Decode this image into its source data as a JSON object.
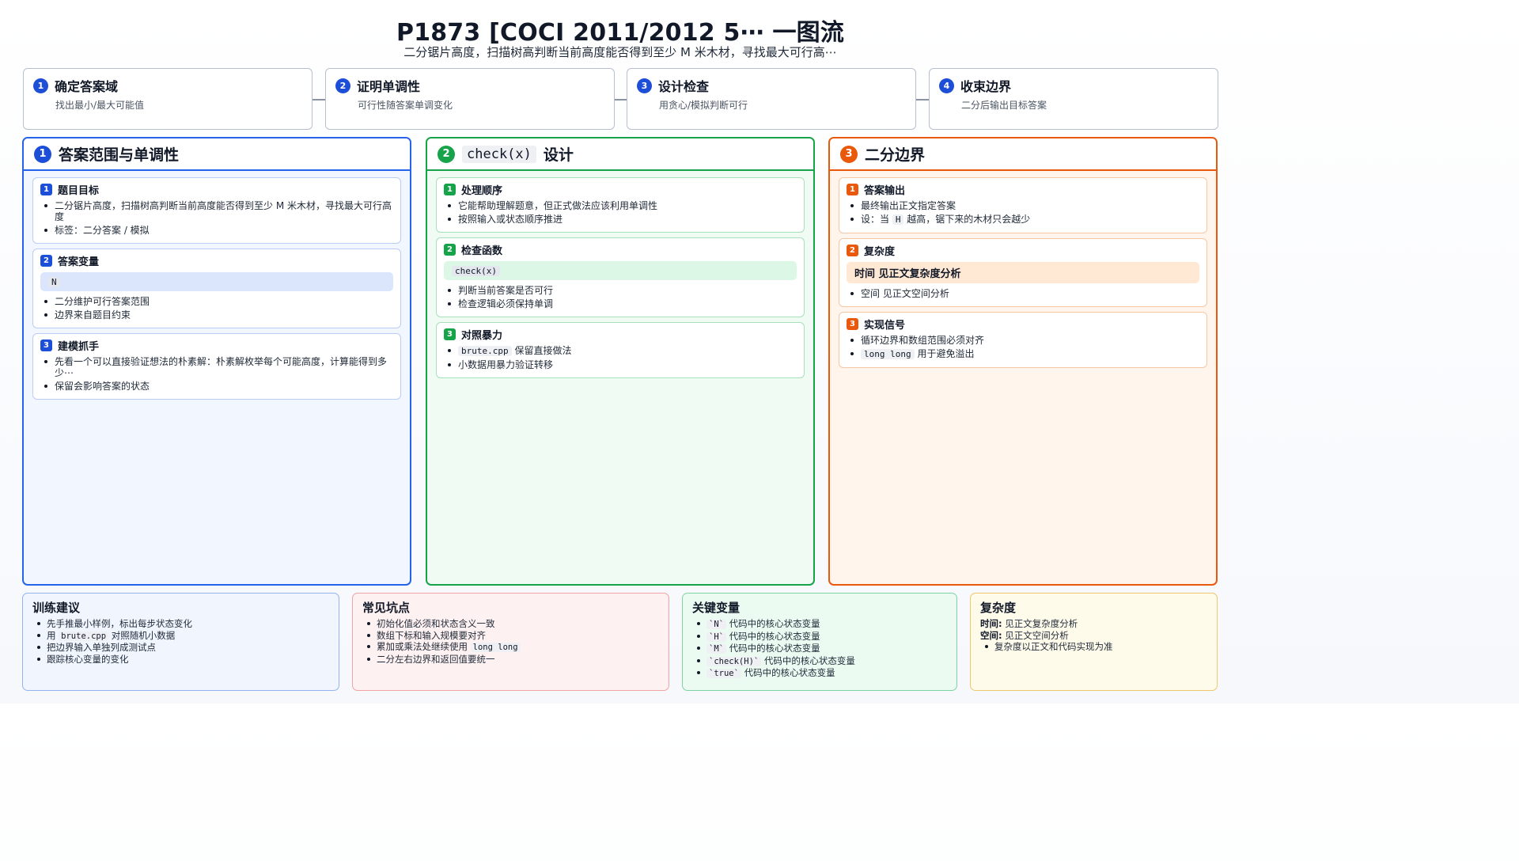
{
  "header": {
    "title": "P1873 [COCI 2011/2012 5⋯ 一图流",
    "subtitle": "二分锯片高度，扫描树高判断当前高度能否得到至少 M 米木材，寻找最大可行高⋯"
  },
  "steps": [
    {
      "num": "1",
      "title": "确定答案域",
      "desc": "找出最小/最大可能值"
    },
    {
      "num": "2",
      "title": "证明单调性",
      "desc": "可行性随答案单调变化"
    },
    {
      "num": "3",
      "title": "设计检查",
      "desc": "用贪心/模拟判断可行"
    },
    {
      "num": "4",
      "title": "收束边界",
      "desc": "二分后输出目标答案"
    }
  ],
  "columns": {
    "c1": {
      "num": "1",
      "title": "答案范围与单调性",
      "cards": [
        {
          "num": "1",
          "title": "题目目标",
          "items": [
            "二分锯片高度，扫描树高判断当前高度能否得到至少 M 米木材，寻找最大可行高度",
            "标签：二分答案 / 模拟"
          ]
        },
        {
          "num": "2",
          "title": "答案变量",
          "highlight": "N",
          "items": [
            "二分维护可行答案范围",
            "边界来自题目约束"
          ]
        },
        {
          "num": "3",
          "title": "建模抓手",
          "items": [
            "先看一个可以直接验证想法的朴素解：朴素解枚举每个可能高度，计算能得到多少⋯",
            "保留会影响答案的状态"
          ]
        }
      ]
    },
    "c2": {
      "num": "2",
      "title_code": "check(x)",
      "title_rest": "设计",
      "cards": [
        {
          "num": "1",
          "title": "处理顺序",
          "items": [
            "它能帮助理解题意，但正式做法应该利用单调性",
            "按照输入或状态顺序推进"
          ]
        },
        {
          "num": "2",
          "title": "检查函数",
          "highlight": "check(x)",
          "items": [
            "判断当前答案是否可行",
            "检查逻辑必须保持单调"
          ]
        },
        {
          "num": "3",
          "title": "对照暴力",
          "item1_code": "brute.cpp",
          "item1_text": "保留直接做法",
          "item2": "小数据用暴力验证转移"
        }
      ]
    },
    "c3": {
      "num": "3",
      "title": "二分边界",
      "cards": [
        {
          "num": "1",
          "title": "答案输出",
          "item1": "最终输出正文指定答案",
          "item2_pre": "设：当",
          "item2_code": "H",
          "item2_post": "越高，锯下来的木材只会越少"
        },
        {
          "num": "2",
          "title": "复杂度",
          "highlight": "时间 见正文复杂度分析",
          "items": [
            "空间 见正文空间分析"
          ]
        },
        {
          "num": "3",
          "title": "实现信号",
          "item1": "循环边界和数组范围必须对齐",
          "item2_code": "long long",
          "item2_text": "用于避免溢出"
        }
      ]
    }
  },
  "bottom": {
    "training": {
      "title": "训练建议",
      "i1": "先手推最小样例，标出每步状态变化",
      "i2_pre": "用",
      "i2_code": "brute.cpp",
      "i2_post": "对照随机小数据",
      "i3": "把边界输入单独列成测试点",
      "i4": "跟踪核心变量的变化"
    },
    "pitfalls": {
      "title": "常见坑点",
      "i1": "初始化值必须和状态含义一致",
      "i2": "数组下标和输入规模要对齐",
      "i3_pre": "累加或乘法处继续使用",
      "i3_code": "long long",
      "i4": "二分左右边界和返回值要统一"
    },
    "keyvars": {
      "title": "关键变量",
      "suffix": "代码中的核心状态变量",
      "vars": [
        "`N`",
        "`H`",
        "`M`",
        "`check(H)`",
        "`true`"
      ]
    },
    "complexity": {
      "title": "复杂度",
      "time_label": "时间:",
      "time_val": "见正文复杂度分析",
      "space_label": "空间:",
      "space_val": "见正文空间分析",
      "note": "复杂度以正文和代码实现为准"
    }
  },
  "colors": {
    "blue": "#2563eb",
    "green": "#16a34a",
    "orange": "#ea580c",
    "red": "#f2a3a3",
    "yellow": "#ecc86a"
  }
}
